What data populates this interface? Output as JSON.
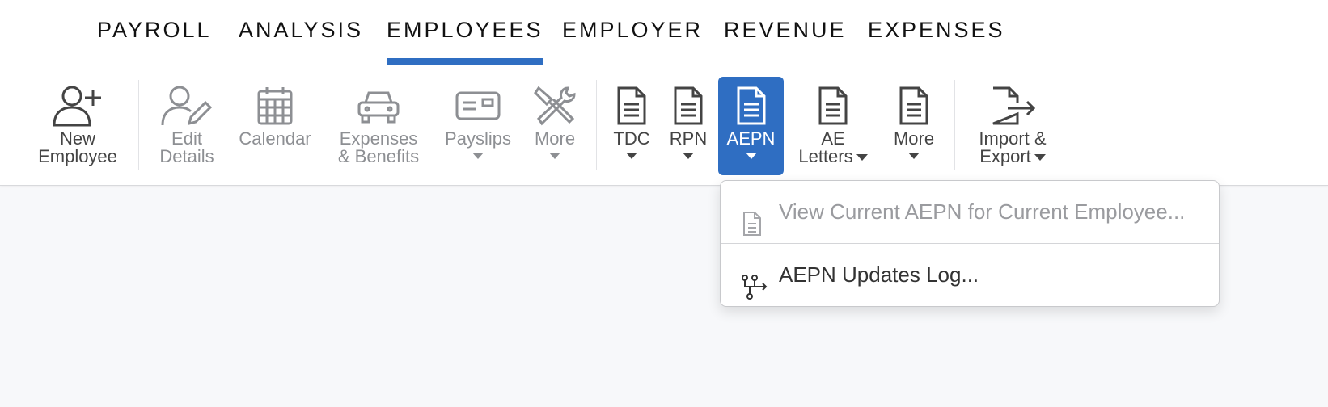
{
  "nav": {
    "tabs": [
      {
        "label": "PAYROLL"
      },
      {
        "label": "ANALYSIS"
      },
      {
        "label": "EMPLOYEES",
        "active": true
      },
      {
        "label": "EMPLOYER"
      },
      {
        "label": "REVENUE"
      },
      {
        "label": "EXPENSES"
      }
    ]
  },
  "ribbon": {
    "new_employee": {
      "line1": "New",
      "line2": "Employee",
      "icon": "add-user-icon"
    },
    "edit_details": {
      "line1": "Edit",
      "line2": "Details",
      "icon": "edit-user-icon",
      "disabled": true
    },
    "calendar": {
      "label": "Calendar",
      "icon": "calendar-icon",
      "disabled": true
    },
    "expenses_benefits": {
      "line1": "Expenses",
      "line2": "& Benefits",
      "icon": "car-icon",
      "disabled": true
    },
    "payslips": {
      "label": "Payslips",
      "icon": "payslip-icon",
      "disabled": true
    },
    "more_tools": {
      "label": "More",
      "icon": "tools-icon",
      "disabled": true
    },
    "tdc": {
      "label": "TDC",
      "icon": "document-icon"
    },
    "rpn": {
      "label": "RPN",
      "icon": "document-icon"
    },
    "aepn": {
      "label": "AEPN",
      "icon": "document-icon",
      "active": true
    },
    "ae_letters": {
      "line1": "AE",
      "line2": "Letters",
      "icon": "document-icon"
    },
    "more_docs": {
      "label": "More",
      "icon": "document-icon"
    },
    "import_export": {
      "line1": "Import &",
      "line2": "Export",
      "icon": "export-icon"
    }
  },
  "dropdown": {
    "items": [
      {
        "label": "View Current AEPN for Current Employee...",
        "icon": "file-icon",
        "disabled": true
      },
      {
        "label": "AEPN Updates Log...",
        "icon": "log-tree-icon"
      }
    ]
  },
  "colors": {
    "accent": "#2f6ec2",
    "background": "#f7f8fa",
    "disabled_text": "#8d8f93"
  }
}
